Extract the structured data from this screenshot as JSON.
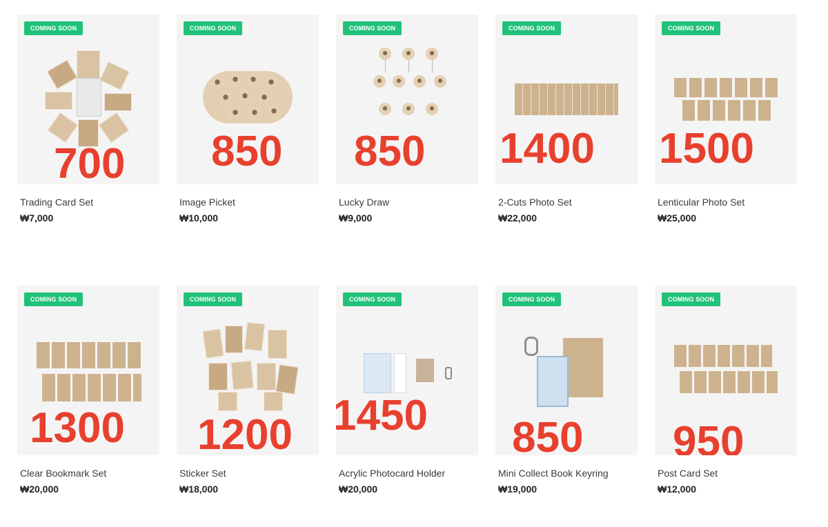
{
  "badge_text": "COMING SOON",
  "currency_color": "#e8402e",
  "badge_color": "#21c17a",
  "products": [
    {
      "name": "Trading Card Set",
      "price": "₩7,000",
      "overlay": "700"
    },
    {
      "name": "Image Picket",
      "price": "₩10,000",
      "overlay": "850"
    },
    {
      "name": "Lucky Draw",
      "price": "₩9,000",
      "overlay": "850"
    },
    {
      "name": "2-Cuts Photo Set",
      "price": "₩22,000",
      "overlay": "1400"
    },
    {
      "name": "Lenticular Photo Set",
      "price": "₩25,000",
      "overlay": "1500"
    },
    {
      "name": "Clear Bookmark Set",
      "price": "₩20,000",
      "overlay": "1300"
    },
    {
      "name": "Sticker Set",
      "price": "₩18,000",
      "overlay": "1200"
    },
    {
      "name": "Acrylic Photocard Holder",
      "price": "₩20,000",
      "overlay": "1450"
    },
    {
      "name": "Mini Collect Book Keyring",
      "price": "₩19,000",
      "overlay": "850"
    },
    {
      "name": "Post Card Set",
      "price": "₩12,000",
      "overlay": "950"
    }
  ]
}
